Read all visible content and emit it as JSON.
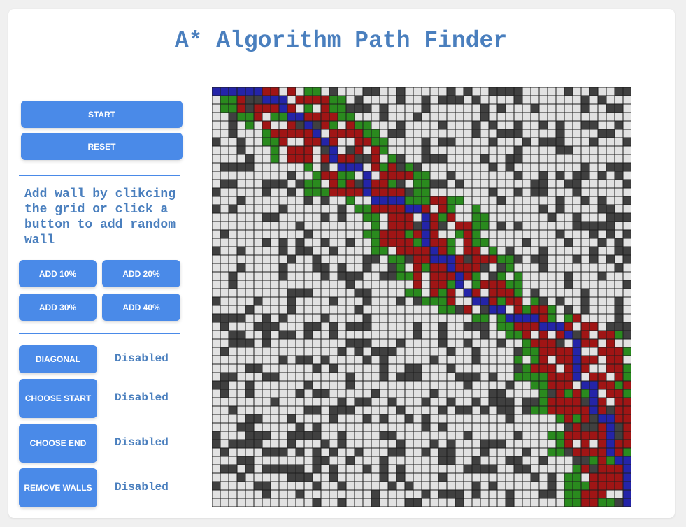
{
  "app": {
    "title": "A* Algorithm Path Finder",
    "help_text": "Add wall by clikcing the grid or click a button to add random wall"
  },
  "controls": {
    "start_label": "START",
    "reset_label": "RESET",
    "add_buttons": [
      "ADD 10%",
      "ADD 20%",
      "ADD 30%",
      "ADD 40%"
    ]
  },
  "toggles": [
    {
      "label": "DIAGONAL",
      "status": "Disabled"
    },
    {
      "label": "CHOOSE START",
      "status": "Disabled"
    },
    {
      "label": "CHOOSE END",
      "status": "Disabled"
    },
    {
      "label": "REMOVE WALLS",
      "status": "Disabled"
    }
  ],
  "grid": {
    "rows": 50,
    "cols": 50,
    "colors": {
      "empty": "#e2e2e2",
      "wall": "#404040",
      "closed": "#a01515",
      "open": "#2a8a1e",
      "path": "#2424a8"
    },
    "path": [
      [
        0,
        0
      ],
      [
        0,
        1
      ],
      [
        0,
        2
      ],
      [
        0,
        3
      ],
      [
        0,
        4
      ],
      [
        0,
        5
      ],
      [
        1,
        6
      ],
      [
        1,
        7
      ],
      [
        1,
        8
      ],
      [
        2,
        8
      ],
      [
        3,
        9
      ],
      [
        3,
        10
      ],
      [
        4,
        11
      ],
      [
        5,
        12
      ],
      [
        6,
        13
      ],
      [
        7,
        14
      ],
      [
        8,
        14
      ],
      [
        9,
        15
      ],
      [
        9,
        16
      ],
      [
        9,
        17
      ],
      [
        10,
        18
      ],
      [
        11,
        18
      ],
      [
        12,
        18
      ],
      [
        13,
        19
      ],
      [
        13,
        20
      ],
      [
        13,
        21
      ],
      [
        13,
        22
      ],
      [
        14,
        23
      ],
      [
        14,
        24
      ],
      [
        15,
        25
      ],
      [
        16,
        25
      ],
      [
        17,
        25
      ],
      [
        18,
        25
      ],
      [
        19,
        26
      ],
      [
        20,
        26
      ],
      [
        20,
        27
      ],
      [
        20,
        28
      ],
      [
        21,
        28
      ],
      [
        22,
        29
      ],
      [
        23,
        29
      ],
      [
        24,
        30
      ],
      [
        25,
        31
      ],
      [
        25,
        32
      ],
      [
        26,
        33
      ],
      [
        26,
        34
      ],
      [
        27,
        35
      ],
      [
        27,
        36
      ],
      [
        27,
        37
      ],
      [
        27,
        38
      ],
      [
        28,
        39
      ],
      [
        28,
        40
      ],
      [
        28,
        41
      ],
      [
        29,
        42
      ],
      [
        30,
        43
      ],
      [
        31,
        43
      ],
      [
        32,
        43
      ],
      [
        33,
        43
      ],
      [
        34,
        43
      ],
      [
        35,
        44
      ],
      [
        35,
        45
      ],
      [
        36,
        45
      ],
      [
        37,
        45
      ],
      [
        38,
        45
      ],
      [
        39,
        46
      ],
      [
        39,
        47
      ],
      [
        40,
        47
      ],
      [
        41,
        47
      ],
      [
        42,
        47
      ],
      [
        43,
        47
      ],
      [
        44,
        48
      ],
      [
        44,
        49
      ],
      [
        45,
        49
      ],
      [
        46,
        49
      ],
      [
        47,
        49
      ],
      [
        48,
        49
      ],
      [
        49,
        49
      ]
    ]
  }
}
